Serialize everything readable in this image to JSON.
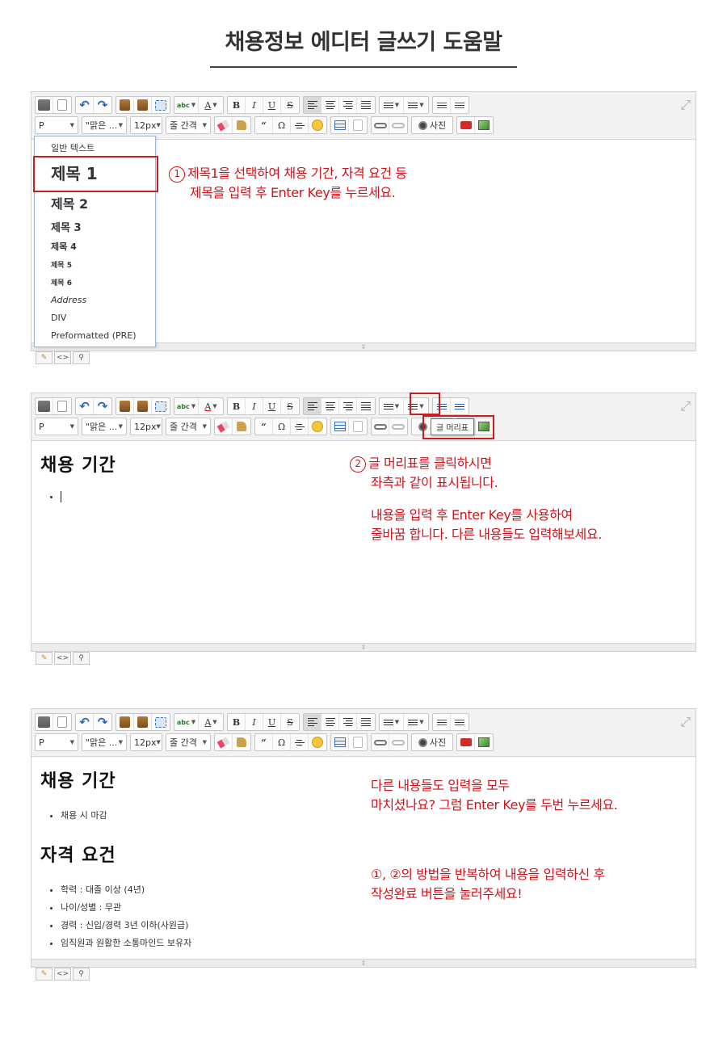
{
  "page_title": "채용정보 에디터 글쓰기 도움말",
  "toolbar": {
    "format_select": "P",
    "font_select": "\"맑은 ...",
    "size_select": "12px",
    "line_height_select": "줄 간격",
    "photo_label": "사진",
    "bold": "B",
    "italic": "I",
    "underline": "U",
    "strike": "S",
    "quote": "“",
    "omega": "Ω",
    "abc": "abc",
    "font_color": "A",
    "expand_symbol": "⤢",
    "resize_symbol": "⇳"
  },
  "mode_tabs": {
    "edit": "✎",
    "html": "<>",
    "preview": "⚲"
  },
  "panel1": {
    "dropdown": {
      "items": [
        "일반 텍스트",
        "제목 1",
        "제목 2",
        "제목 3",
        "제목 4",
        "제목 5",
        "제목 6",
        "Address",
        "DIV",
        "Preformatted (PRE)"
      ]
    },
    "note": {
      "number": "①",
      "line1": "제목1을 선택하여 채용 기간, 자격 요건 등",
      "line2": "제목을 입력 후 Enter Key를 누르세요."
    }
  },
  "panel2": {
    "heading": "채용 기간",
    "tooltip": "글 머리표",
    "note": {
      "number": "②",
      "line1": "글 머리표를 클릭하시면",
      "line2": "좌측과 같이 표시됩니다.",
      "line3": "내용을 입력 후 Enter Key를 사용하여",
      "line4": "줄바꿈 합니다. 다른 내용들도 입력해보세요."
    }
  },
  "panel3": {
    "heading1": "채용 기간",
    "list1": [
      "채용 시 마감"
    ],
    "heading2": "자격 요건",
    "list2": [
      "학력 : 대졸 이상 (4년)",
      "나이/성별 : 무관",
      "경력 : 신입/경력 3년 이하(사원급)",
      "임직원과 원활한 소통마인드 보유자"
    ],
    "note1": {
      "line1": "다른 내용들도 입력을 모두",
      "line2": "마치셨나요? 그럼 Enter Key를 두번 누르세요."
    },
    "note2": {
      "line1": "①, ②의 방법을 반복하여 내용을 입력하신 후",
      "line2": "작성완료 버튼을 눌러주세요!"
    }
  }
}
